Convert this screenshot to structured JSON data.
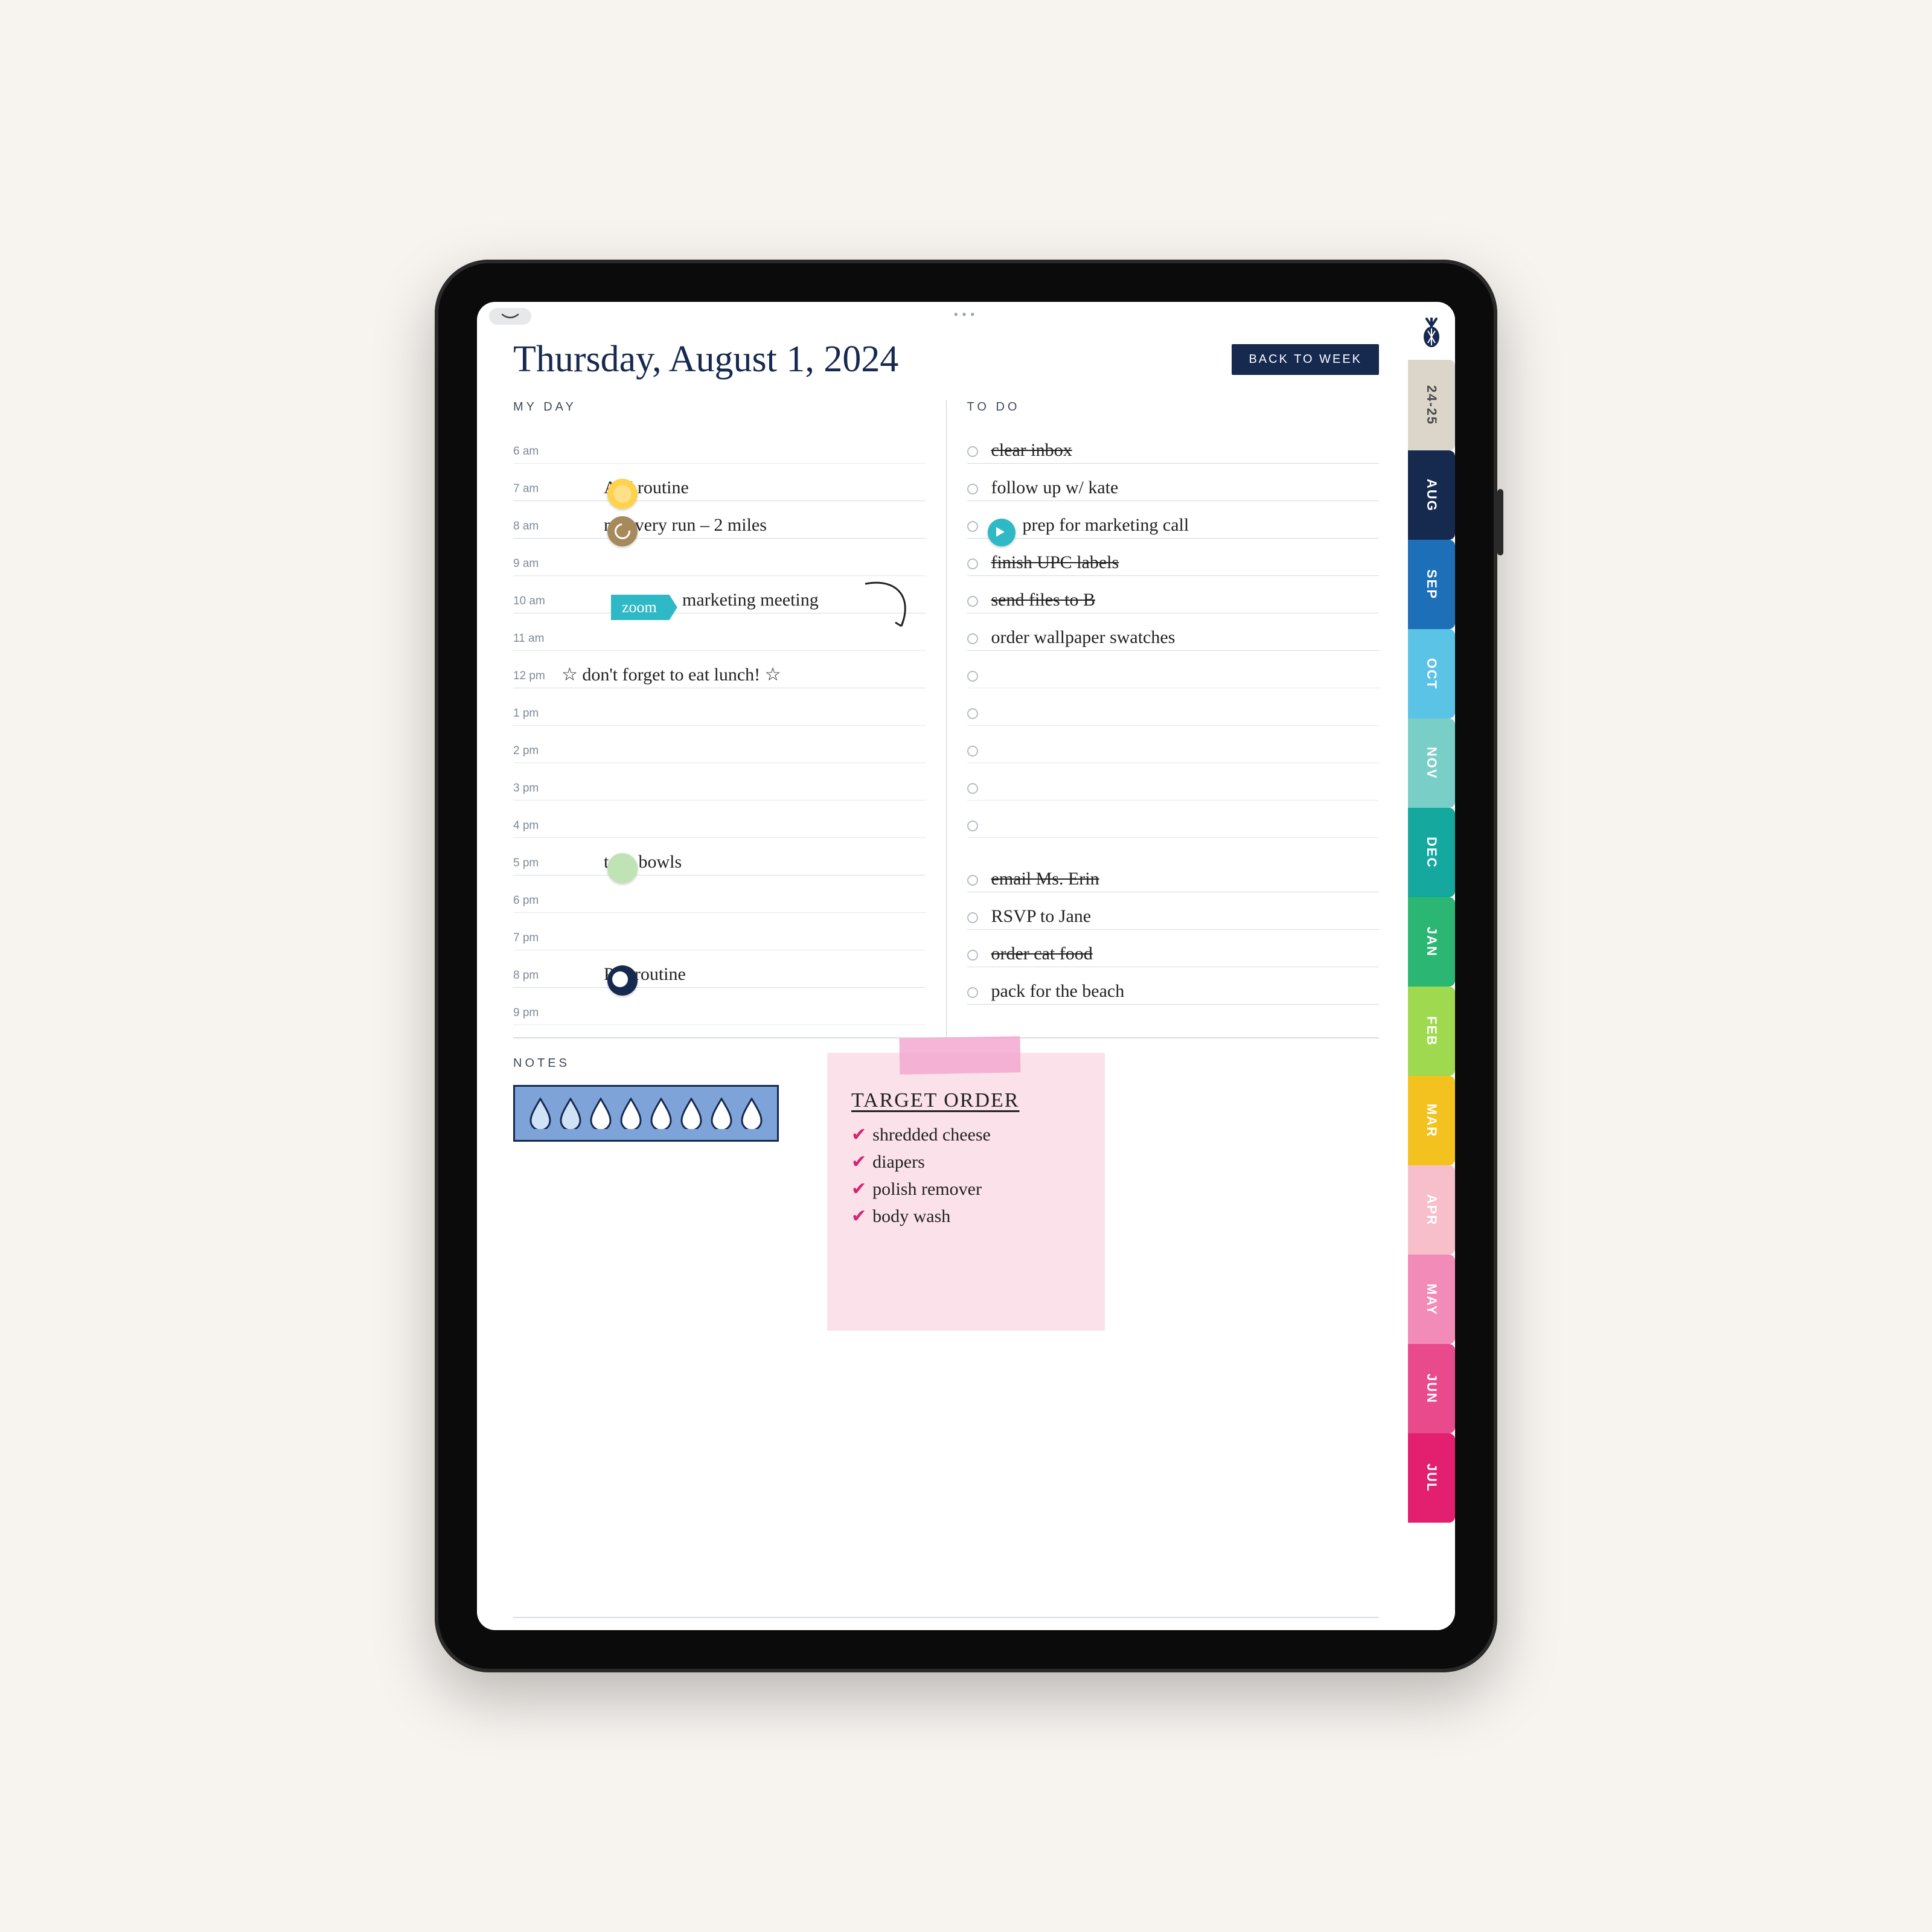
{
  "header": {
    "title": "Thursday, August 1, 2024",
    "back_label": "BACK TO WEEK"
  },
  "sections": {
    "my_day": "MY DAY",
    "to_do": "TO DO",
    "notes": "NOTES"
  },
  "hours": [
    {
      "label": "6 am",
      "text": ""
    },
    {
      "label": "7 am",
      "text": "AM routine",
      "sticker": "sun"
    },
    {
      "label": "8 am",
      "text": "recovery run – 2 miles",
      "sticker": "run"
    },
    {
      "label": "9 am",
      "text": ""
    },
    {
      "label": "10 am",
      "text": "marketing meeting",
      "tag": "zoom",
      "arrow": true
    },
    {
      "label": "11 am",
      "text": ""
    },
    {
      "label": "12 pm",
      "text": "☆ don't forget to eat lunch! ☆"
    },
    {
      "label": "1 pm",
      "text": ""
    },
    {
      "label": "2 pm",
      "text": ""
    },
    {
      "label": "3 pm",
      "text": ""
    },
    {
      "label": "4 pm",
      "text": ""
    },
    {
      "label": "5 pm",
      "text": "taco bowls",
      "sticker": "green"
    },
    {
      "label": "6 pm",
      "text": ""
    },
    {
      "label": "7 pm",
      "text": ""
    },
    {
      "label": "8 pm",
      "text": "PM routine",
      "sticker": "moon"
    },
    {
      "label": "9 pm",
      "text": ""
    }
  ],
  "todos_a": [
    {
      "text": "clear inbox",
      "done": true
    },
    {
      "text": "follow up w/ kate",
      "done": false
    },
    {
      "text": "prep for marketing call",
      "done": true,
      "sticker": "teal"
    },
    {
      "text": "finish UPC labels",
      "done": true
    },
    {
      "text": "send files to B",
      "done": true
    },
    {
      "text": "order wallpaper swatches",
      "done": false
    },
    {
      "text": "",
      "done": false
    },
    {
      "text": "",
      "done": false
    },
    {
      "text": "",
      "done": false
    },
    {
      "text": "",
      "done": false
    },
    {
      "text": "",
      "done": false
    }
  ],
  "todos_b": [
    {
      "text": "email Ms. Erin",
      "done": true
    },
    {
      "text": "RSVP to Jane",
      "done": false
    },
    {
      "text": "order cat food",
      "done": true
    },
    {
      "text": "pack for the beach",
      "done": false
    }
  ],
  "water": {
    "total": 8,
    "filled": 2
  },
  "sticky": {
    "title": "TARGET ORDER",
    "items": [
      "shredded cheese",
      "diapers",
      "polish remover",
      "body wash"
    ]
  },
  "tabs": [
    {
      "label": "24-25",
      "bg": "#dbd6c9",
      "fg": "#4a4a4a",
      "kind": "year"
    },
    {
      "label": "AUG",
      "bg": "#16294f",
      "fg": "#ffffff"
    },
    {
      "label": "SEP",
      "bg": "#1d6fb8",
      "fg": "#ffffff"
    },
    {
      "label": "OCT",
      "bg": "#5bc4e6",
      "fg": "#ffffff"
    },
    {
      "label": "NOV",
      "bg": "#79cfc7",
      "fg": "#ffffff"
    },
    {
      "label": "DEC",
      "bg": "#14a89e",
      "fg": "#ffffff"
    },
    {
      "label": "JAN",
      "bg": "#2bb673",
      "fg": "#ffffff"
    },
    {
      "label": "FEB",
      "bg": "#9fd94f",
      "fg": "#ffffff"
    },
    {
      "label": "MAR",
      "bg": "#f4c21f",
      "fg": "#ffffff"
    },
    {
      "label": "APR",
      "bg": "#f6bfca",
      "fg": "#ffffff"
    },
    {
      "label": "MAY",
      "bg": "#f28bb8",
      "fg": "#ffffff"
    },
    {
      "label": "JUN",
      "bg": "#e94a8c",
      "fg": "#ffffff"
    },
    {
      "label": "JUL",
      "bg": "#e2206f",
      "fg": "#ffffff"
    }
  ]
}
